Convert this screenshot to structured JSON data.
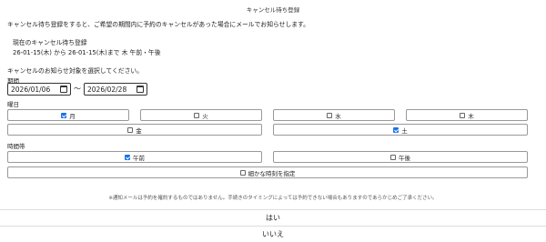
{
  "header": {
    "title": "キャンセル待ち登録"
  },
  "intro": "キャンセル待ち登録をすると、ご希望の期間内に予約のキャンセルがあった場合にメールでお知らせします。",
  "current": {
    "label": "現在のキャンセル待ち登録",
    "value": "26-01-15(木) から 26-01-15(木)まで 木 午前・午後"
  },
  "prompt": "キャンセルのお知らせ対象を選択してください。",
  "period": {
    "label": "期間",
    "start": "2026/01/06",
    "separator": "～",
    "end": "2026/02/28"
  },
  "weekdays": {
    "label": "曜日",
    "items": [
      {
        "label": "月",
        "checked": true
      },
      {
        "label": "火",
        "checked": false
      },
      {
        "label": "水",
        "checked": false
      },
      {
        "label": "木",
        "checked": false
      },
      {
        "label": "金",
        "checked": false
      },
      {
        "label": "土",
        "checked": true
      }
    ]
  },
  "time": {
    "label": "時間帯",
    "items": [
      {
        "label": "午前",
        "checked": true
      },
      {
        "label": "午後",
        "checked": false
      }
    ],
    "detail_label": "細かな時刻を指定",
    "detail_checked": false
  },
  "note": "※通知メールは予約を確約するものではありません。手続きのタイミングによっては予約できない場合もありますのであらかじめご了承ください。",
  "actions": {
    "yes": "はい",
    "no": "いいえ"
  },
  "colors": {
    "checkbox_on": "#1a73e8"
  }
}
